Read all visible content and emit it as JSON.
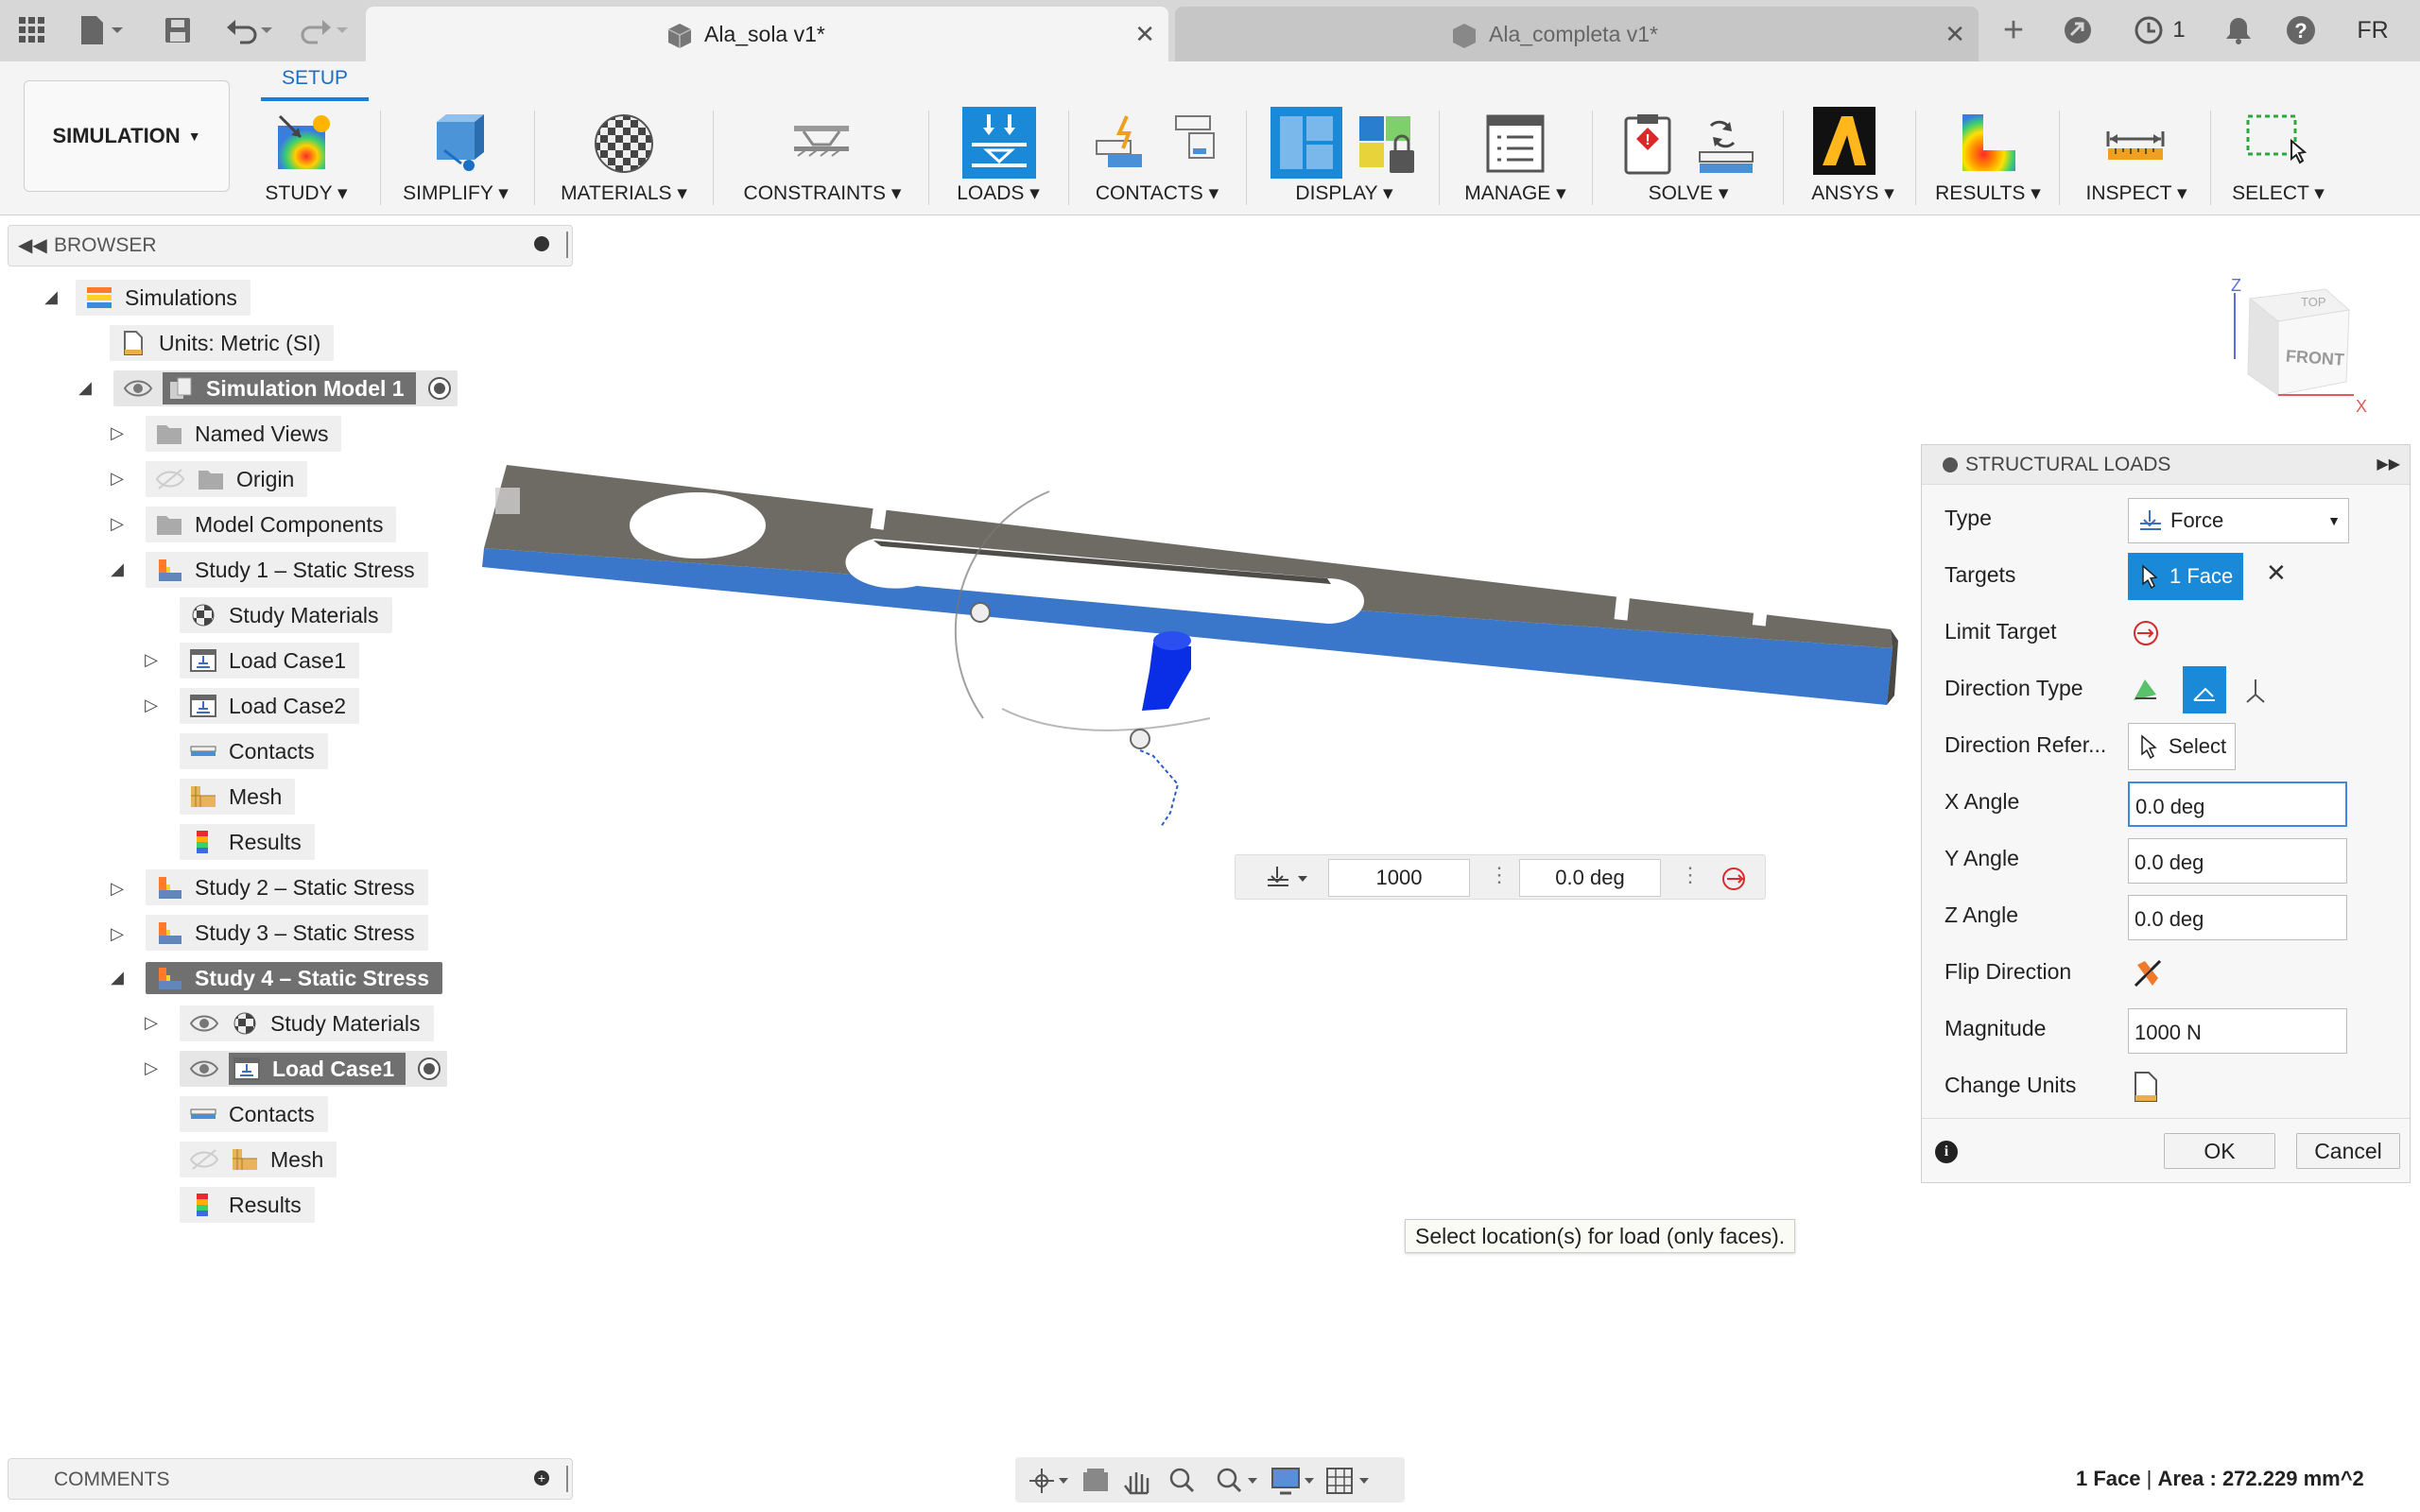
{
  "tabs": [
    {
      "label": "Ala_sola v1*"
    },
    {
      "label": "Ala_completa v1*"
    }
  ],
  "topbar": {
    "job_count": "1",
    "user_initials": "FR"
  },
  "ribbon": {
    "workspace_label": "SIMULATION",
    "active_tab": "SETUP",
    "groups": [
      {
        "label": "STUDY"
      },
      {
        "label": "SIMPLIFY"
      },
      {
        "label": "MATERIALS"
      },
      {
        "label": "CONSTRAINTS"
      },
      {
        "label": "LOADS"
      },
      {
        "label": "CONTACTS"
      },
      {
        "label": "DISPLAY"
      },
      {
        "label": "MANAGE"
      },
      {
        "label": "SOLVE"
      },
      {
        "label": "ANSYS"
      },
      {
        "label": "RESULTS"
      },
      {
        "label": "INSPECT"
      },
      {
        "label": "SELECT"
      }
    ]
  },
  "browser": {
    "title": "BROWSER",
    "items": [
      {
        "label": "Simulations"
      },
      {
        "label": "Units: Metric (SI)"
      },
      {
        "label": "Simulation Model 1"
      },
      {
        "label": "Named Views"
      },
      {
        "label": "Origin"
      },
      {
        "label": "Model Components"
      },
      {
        "label": "Study 1 – Static Stress"
      },
      {
        "label": "Study Materials"
      },
      {
        "label": "Load Case1"
      },
      {
        "label": "Load Case2"
      },
      {
        "label": "Contacts"
      },
      {
        "label": "Mesh"
      },
      {
        "label": "Results"
      },
      {
        "label": "Study 2 – Static Stress"
      },
      {
        "label": "Study 3 – Static Stress"
      },
      {
        "label": "Study 4 – Static Stress"
      },
      {
        "label": "Study Materials"
      },
      {
        "label": "Load Case1"
      },
      {
        "label": "Contacts"
      },
      {
        "label": "Mesh"
      },
      {
        "label": "Results"
      }
    ]
  },
  "viewcube": {
    "top": "TOP",
    "front": "FRONT",
    "axis_z": "Z",
    "axis_x": "X"
  },
  "inline_toolbar": {
    "magnitude": "1000",
    "angle": "0.0 deg"
  },
  "hint": "Select location(s) for load (only faces).",
  "panel": {
    "title": "STRUCTURAL LOADS",
    "type_label": "Type",
    "type_value": "Force",
    "targets_label": "Targets",
    "targets_value": "1 Face",
    "limit_target_label": "Limit Target",
    "direction_type_label": "Direction Type",
    "direction_ref_label": "Direction Refer...",
    "direction_ref_value": "Select",
    "x_angle_label": "X Angle",
    "x_angle_value": "0.0 deg",
    "y_angle_label": "Y Angle",
    "y_angle_value": "0.0 deg",
    "z_angle_label": "Z Angle",
    "z_angle_value": "0.0 deg",
    "flip_label": "Flip Direction",
    "magnitude_label": "Magnitude",
    "magnitude_value": "1000 N",
    "change_units_label": "Change Units",
    "ok_label": "OK",
    "cancel_label": "Cancel"
  },
  "comments": {
    "title": "COMMENTS"
  },
  "status": {
    "selection": "1 Face",
    "area_label": "Area :",
    "area_value": "272.229 mm^2"
  },
  "colors": {
    "accent": "#1a7dd6",
    "selection_blue": "#3a76c9",
    "model_gray": "#6e6b64"
  }
}
